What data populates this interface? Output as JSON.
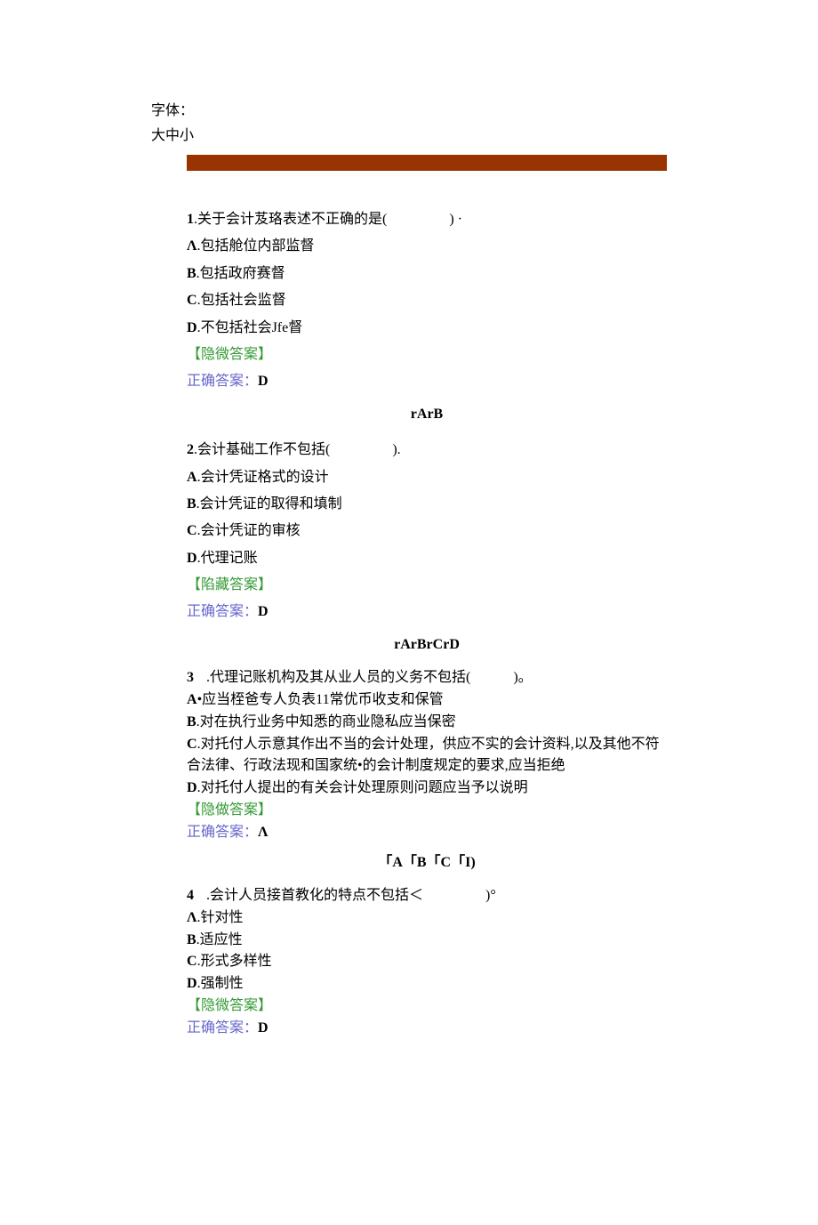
{
  "header": {
    "font_label": "字体：",
    "font_sizes": "大中小"
  },
  "questions": [
    {
      "num": "1",
      "stem_pre": ".关于会计芨珞表述不正确的是(",
      "stem_post": ") ·",
      "options": [
        {
          "k": "Λ",
          "t": ".包括舱位内部监督"
        },
        {
          "k": "B",
          "t": ".包括政府赛督"
        },
        {
          "k": "C",
          "t": ".包括社会监督"
        },
        {
          "k": "D",
          "t": ".不包括社会Jfe督"
        }
      ],
      "toggle": "【隐微答案】",
      "correct_label": "正确答案：",
      "correct": "D",
      "bubbles": "rArB"
    },
    {
      "num": "2",
      "stem_pre": ".会计基础工作不包括(",
      "stem_post": ").",
      "options": [
        {
          "k": "A",
          "t": ".会计凭证格式的设计"
        },
        {
          "k": "B",
          "t": ".会计凭证的取得和填制"
        },
        {
          "k": "C",
          "t": ".会计凭证的审核"
        },
        {
          "k": "D",
          "t": ".代理记账"
        }
      ],
      "toggle": "【陷藏答案】",
      "correct_label": "正确答案：",
      "correct": "D",
      "bubbles": "rArBrCrD"
    },
    {
      "num": "3",
      "stem_pre": ".代理记账机构及其从业人员的义务不包括(",
      "stem_post": ")。",
      "options": [
        {
          "k": "A",
          "t": "•应当桎爸专人负表11常优币收支和保管"
        },
        {
          "k": "B",
          "t": ".对在执行业务中知悉的商业隐私应当保密"
        },
        {
          "k": "C",
          "t": ".对托付人示意其作出不当的会计处理，供应不实的会计资料,以及其他不符合法律、行政法现和国家统•的会计制度规定的要求,应当拒绝"
        },
        {
          "k": "D",
          "t": ".对托付人提出的有关会计处理原则问题应当予以说明"
        }
      ],
      "toggle": "【隐做答案】",
      "correct_label": "正确答案：",
      "correct": "Λ",
      "bubbles": "「A「B「C「I)"
    },
    {
      "num": "4",
      "stem_pre": ".会计人员接首教化的特点不包括＜",
      "stem_post": ")°",
      "options": [
        {
          "k": "Λ",
          "t": ".针对性"
        },
        {
          "k": "B",
          "t": ".适应性"
        },
        {
          "k": "C",
          "t": ".形式多样性"
        },
        {
          "k": "D",
          "t": ".强制性"
        }
      ],
      "toggle": "【隐微答案】",
      "correct_label": "正确答案：",
      "correct": "D",
      "bubbles": ""
    }
  ]
}
